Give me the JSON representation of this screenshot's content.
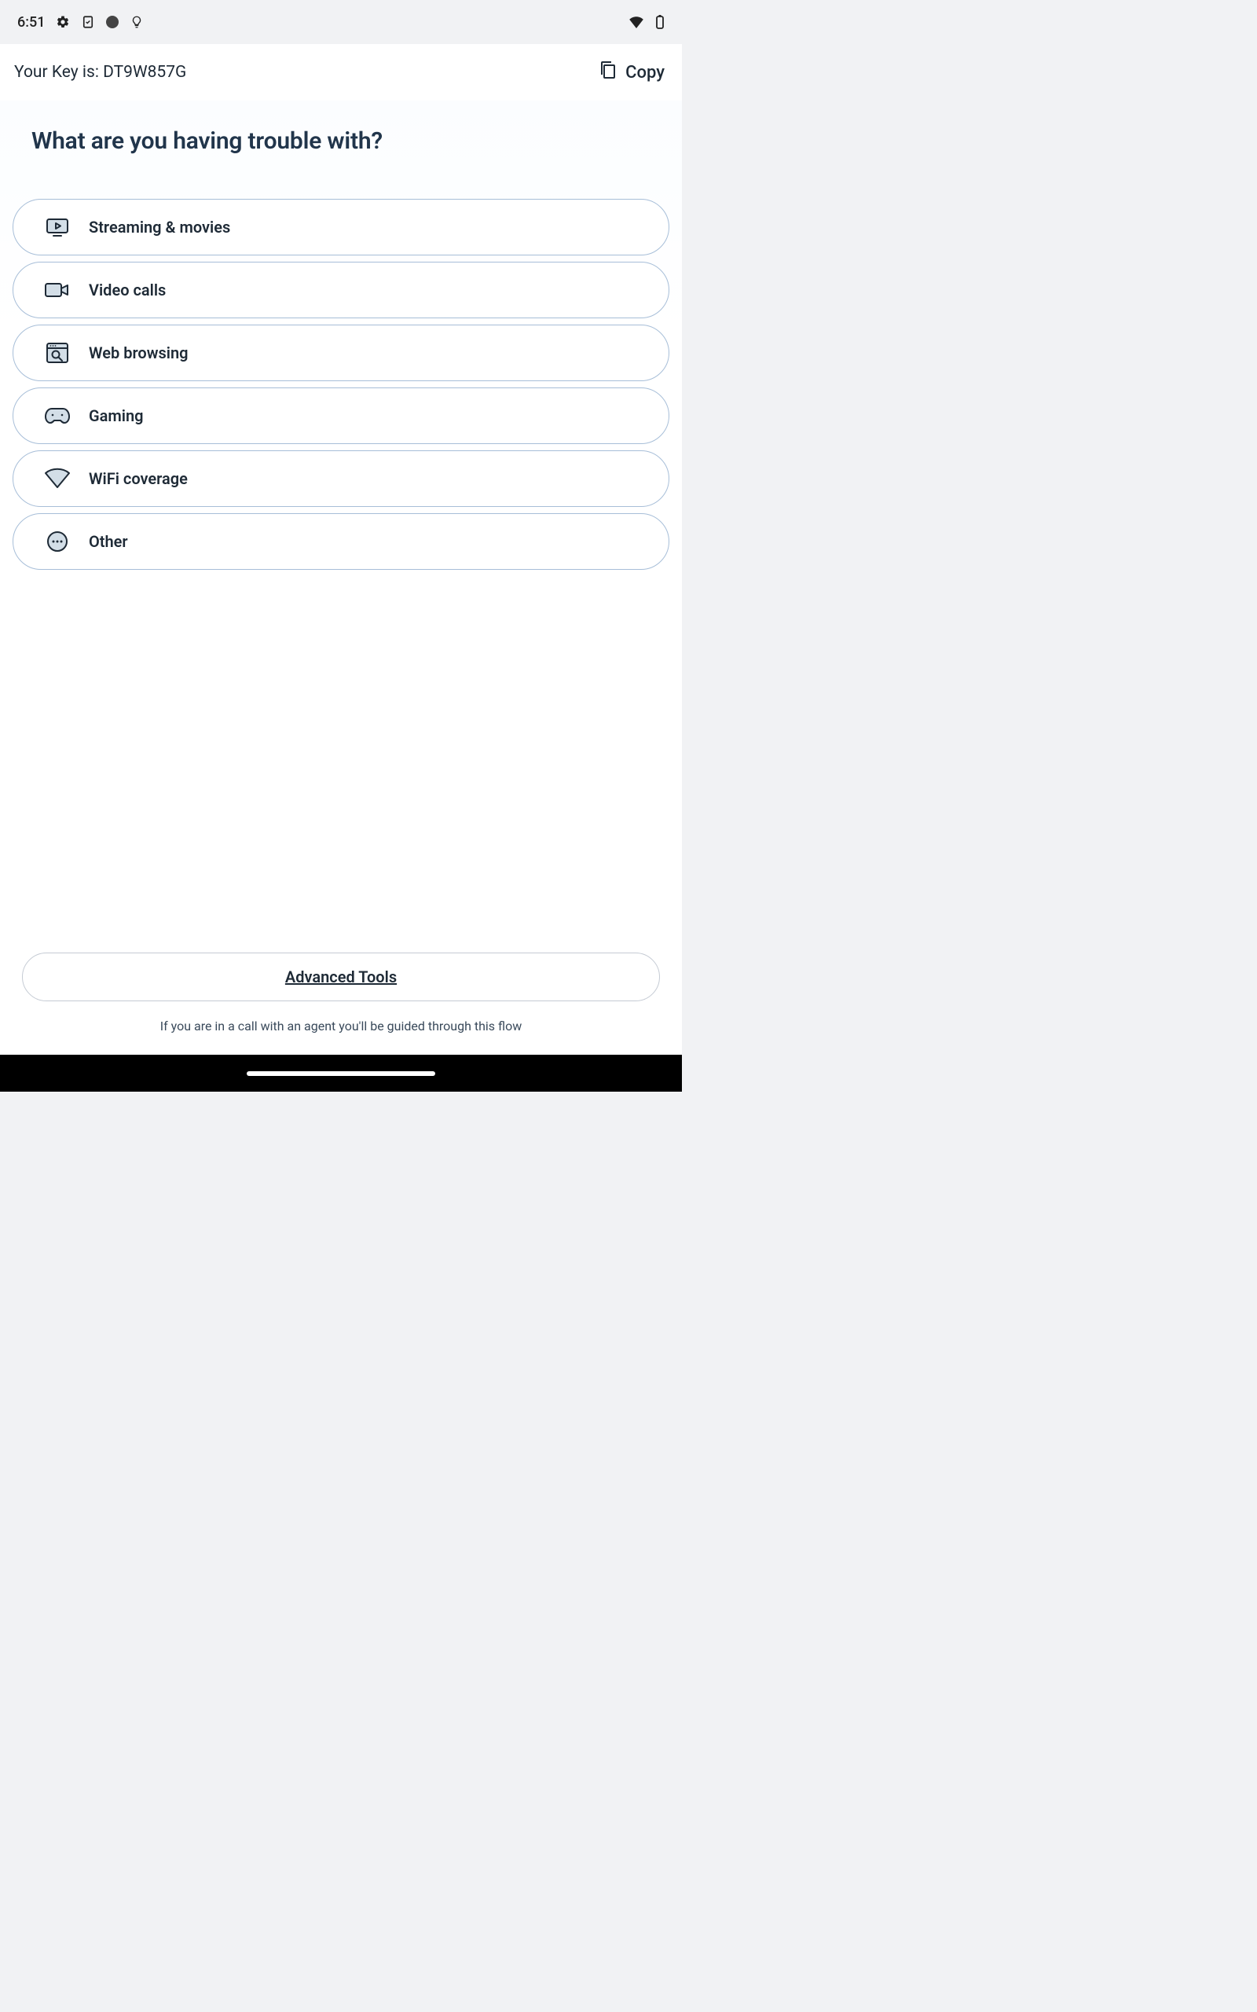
{
  "status_bar": {
    "time": "6:51"
  },
  "key_bar": {
    "label": "Your Key is: DT9W857G",
    "copy_label": "Copy"
  },
  "main": {
    "question": "What are you having trouble with?",
    "options": [
      {
        "label": "Streaming & movies",
        "icon": "play-video-icon"
      },
      {
        "label": "Video calls",
        "icon": "video-camera-icon"
      },
      {
        "label": "Web browsing",
        "icon": "browser-search-icon"
      },
      {
        "label": "Gaming",
        "icon": "gamepad-icon"
      },
      {
        "label": "WiFi coverage",
        "icon": "wifi-triangle-icon"
      },
      {
        "label": "Other",
        "icon": "more-dots-icon"
      }
    ],
    "advanced_label": "Advanced Tools",
    "footer_note": "If you are in a call with an agent you'll be guided through this flow"
  }
}
